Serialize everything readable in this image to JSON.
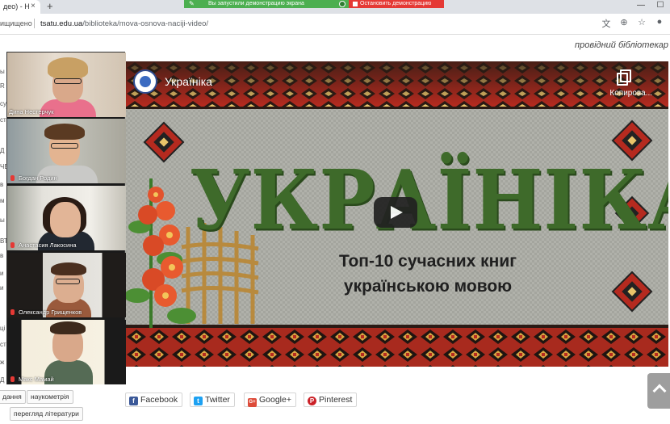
{
  "browser": {
    "tab_title": "део) - Н",
    "tab_close": "×",
    "new_tab": "+",
    "share_message": "Вы запустили демонстрацию экрана",
    "share_stop": "Остановить демонстрацию",
    "window_controls": [
      "—",
      "☐"
    ],
    "security_label": "ищищено",
    "url_domain": "tsatu.edu.ua",
    "url_path": "/biblioteka/mova-osnova-naciji-video/"
  },
  "page": {
    "librarian_text": "провідний бібліотекар",
    "left_fragments": [
      "ы",
      "R",
      "су",
      "ст",
      "Д",
      "ЧЕ",
      "в",
      "м",
      "ы",
      "ВТ",
      "в",
      "и",
      "и",
      "ці",
      "ст",
      "ж",
      "Д"
    ]
  },
  "video": {
    "channel_name": "Україніка",
    "copy_label": "Копирова...",
    "title_art": "УКРАЇНІКА",
    "subtitle_line1": "Топ-10 сучасних книг",
    "subtitle_line2": "українською мовою"
  },
  "participants": [
    {
      "name": "Дина Нестерчук",
      "muted": false
    },
    {
      "name": "Богдан Родин",
      "muted": true
    },
    {
      "name": "Анастасия Лакосина",
      "muted": true
    },
    {
      "name": "Олександр Грищенков",
      "muted": true
    },
    {
      "name": "Макс Мамай",
      "muted": true
    }
  ],
  "tags": [
    "дання",
    "наукометрія",
    "перегляд літератури"
  ],
  "share_buttons": [
    {
      "label": "Facebook",
      "icon": "f",
      "color": "#3b5998"
    },
    {
      "label": "Twitter",
      "icon": "t",
      "color": "#1da1f2"
    },
    {
      "label": "Google+",
      "icon": "G+",
      "color": "#dd4b39"
    },
    {
      "label": "Pinterest",
      "icon": "P",
      "color": "#cb2027"
    }
  ]
}
